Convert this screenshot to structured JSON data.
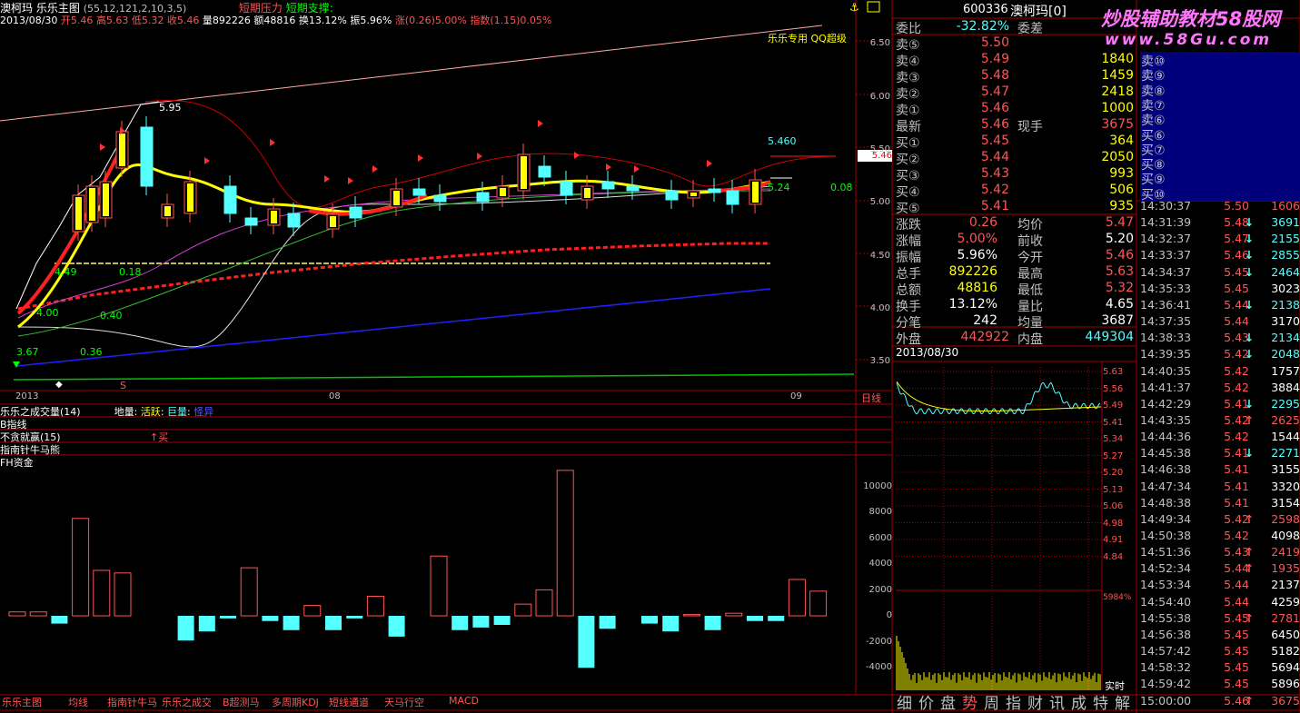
{
  "header": {
    "stock_name": "澳柯玛",
    "indicator_title": "乐乐主图",
    "indicator_params": "(55,12,121,2,10,3,5)",
    "pressure_label": "短期压力",
    "support_label": "短期支撑:",
    "date": "2013/08/30",
    "open": "开5.46",
    "high": "高5.63",
    "low": "低5.32",
    "close": "收5.46",
    "volume": "量892226",
    "amount": "额48816",
    "turnover": "换13.12%",
    "amplitude": "振5.96%",
    "change": "涨(0.26)5.00%",
    "index": "指数(1.15)0.05%"
  },
  "chart_annotations": {
    "special_label": "乐乐专用  QQ超级",
    "high_mark": "5.95",
    "right_mark": "5.460",
    "value_524": "5.24",
    "value_008": "0.08",
    "value_018": "0.18",
    "value_040": "0.40",
    "value_036": "0.36",
    "value_367": "3.67",
    "value_400": "4.00",
    "value_449": "4.49",
    "current_price_tag": "5.46",
    "price_axis": [
      "6.50",
      "6.00",
      "5.50",
      "5.00",
      "4.50",
      "4.00",
      "3.50"
    ],
    "date_axis": [
      "2013",
      "08",
      "09"
    ],
    "sub_tab": "日线"
  },
  "indicators": {
    "ind1_name": "乐乐之成交量(14)",
    "ind1_items": [
      "地量",
      "活跃",
      "巨量",
      "怪异"
    ],
    "ind2_name": "B指线",
    "ind3_name": "不贪就赢(15)",
    "ind3_signal": "买",
    "ind4_name": "指南针牛马熊",
    "ind5_name": "FH资金",
    "fund_axis": [
      "10000",
      "8000",
      "6000",
      "4000",
      "2000",
      "0",
      "-2000",
      "-4000"
    ]
  },
  "chart_data": {
    "type": "bar",
    "title": "FH资金",
    "values": [
      300,
      300,
      -600,
      7500,
      3500,
      3300,
      0,
      0,
      -1900,
      -1200,
      -200,
      3700,
      -400,
      -1100,
      800,
      -1100,
      -200,
      1500,
      -1600,
      0,
      4600,
      -1100,
      -900,
      -700,
      900,
      2000,
      11200,
      -4000,
      -1000,
      0,
      -600,
      -1200,
      100,
      -1100,
      200,
      -400,
      -400,
      2800,
      1900
    ],
    "ylim": [
      -5000,
      11500
    ]
  },
  "quote": {
    "code": "600336",
    "name": "澳柯玛[0]",
    "weibi_label": "委比",
    "weibi_value": "-32.82%",
    "weicha_label": "委差",
    "sells": [
      {
        "label": "卖⑤",
        "price": "5.50",
        "vol": ""
      },
      {
        "label": "卖④",
        "price": "5.49",
        "vol": "1840"
      },
      {
        "label": "卖③",
        "price": "5.48",
        "vol": "1459"
      },
      {
        "label": "卖②",
        "price": "5.47",
        "vol": "2418"
      },
      {
        "label": "卖①",
        "price": "5.46",
        "vol": "1000"
      }
    ],
    "latest_label": "最新",
    "latest_price": "5.46",
    "now_hand_label": "现手",
    "now_hand": "3675",
    "buys": [
      {
        "label": "买①",
        "price": "5.45",
        "vol": "364"
      },
      {
        "label": "买②",
        "price": "5.44",
        "vol": "2050"
      },
      {
        "label": "买③",
        "price": "5.43",
        "vol": "993"
      },
      {
        "label": "买④",
        "price": "5.42",
        "vol": "506"
      },
      {
        "label": "买⑤",
        "price": "5.41",
        "vol": "935"
      }
    ],
    "stats": [
      {
        "l1": "涨跌",
        "v1": "0.26",
        "l2": "均价",
        "v2": "5.47"
      },
      {
        "l1": "涨幅",
        "v1": "5.00%",
        "l2": "前收",
        "v2": "5.20"
      },
      {
        "l1": "振幅",
        "v1": "5.96%",
        "l2": "今开",
        "v2": "5.46"
      },
      {
        "l1": "总手",
        "v1": "892226",
        "l2": "最高",
        "v2": "5.63"
      },
      {
        "l1": "总额",
        "v1": "48816",
        "l2": "最低",
        "v2": "5.32"
      },
      {
        "l1": "换手",
        "v1": "13.12%",
        "l2": "量比",
        "v2": "4.65"
      },
      {
        "l1": "分笔",
        "v1": "242",
        "l2": "均量",
        "v2": "3687"
      }
    ],
    "outer_label": "外盘",
    "outer_value": "442922",
    "inner_label": "内盘",
    "inner_value": "449304",
    "mini_date": "2013/08/30",
    "mini_axis": [
      "5.63",
      "5.56",
      "5.49",
      "5.41",
      "5.34",
      "5.27",
      "5.20",
      "5.13",
      "5.06",
      "4.98",
      "4.91",
      "4.84"
    ],
    "mini_pct": "5984%",
    "realtime_label": "实时"
  },
  "depth_labels": [
    "卖⑩",
    "卖⑨",
    "卖⑧",
    "卖⑦",
    "卖⑥",
    "买⑥",
    "买⑦",
    "买⑧",
    "买⑨",
    "买⑩"
  ],
  "ticks": [
    {
      "t": "14:30:37",
      "p": "5.50",
      "a": "",
      "v": "1606",
      "c": "red"
    },
    {
      "t": "14:31:39",
      "p": "5.48",
      "a": "↓",
      "v": "3691",
      "c": "cyan"
    },
    {
      "t": "14:32:37",
      "p": "5.47",
      "a": "↓",
      "v": "2155",
      "c": "cyan"
    },
    {
      "t": "14:33:37",
      "p": "5.46",
      "a": "↓",
      "v": "2855",
      "c": "cyan"
    },
    {
      "t": "14:34:37",
      "p": "5.45",
      "a": "↓",
      "v": "2464",
      "c": "cyan"
    },
    {
      "t": "14:35:33",
      "p": "5.45",
      "a": "",
      "v": "3023",
      "c": "wht"
    },
    {
      "t": "14:36:41",
      "p": "5.44",
      "a": "↓",
      "v": "2138",
      "c": "cyan"
    },
    {
      "t": "14:37:35",
      "p": "5.44",
      "a": "",
      "v": "3170",
      "c": "wht"
    },
    {
      "t": "14:38:33",
      "p": "5.43",
      "a": "↓",
      "v": "2134",
      "c": "cyan"
    },
    {
      "t": "14:39:35",
      "p": "5.42",
      "a": "↓",
      "v": "2048",
      "c": "cyan"
    },
    {
      "t": "14:40:35",
      "p": "5.42",
      "a": "",
      "v": "1757",
      "c": "wht"
    },
    {
      "t": "14:41:37",
      "p": "5.42",
      "a": "",
      "v": "3884",
      "c": "wht"
    },
    {
      "t": "14:42:29",
      "p": "5.41",
      "a": "↓",
      "v": "2295",
      "c": "cyan"
    },
    {
      "t": "14:43:35",
      "p": "5.42",
      "a": "↑",
      "v": "2625",
      "c": "red"
    },
    {
      "t": "14:44:36",
      "p": "5.42",
      "a": "",
      "v": "1544",
      "c": "wht"
    },
    {
      "t": "14:45:38",
      "p": "5.41",
      "a": "↓",
      "v": "2271",
      "c": "cyan"
    },
    {
      "t": "14:46:38",
      "p": "5.41",
      "a": "",
      "v": "3155",
      "c": "wht"
    },
    {
      "t": "14:47:34",
      "p": "5.41",
      "a": "",
      "v": "3320",
      "c": "wht"
    },
    {
      "t": "14:48:38",
      "p": "5.41",
      "a": "",
      "v": "3154",
      "c": "wht"
    },
    {
      "t": "14:49:34",
      "p": "5.42",
      "a": "↑",
      "v": "2598",
      "c": "red"
    },
    {
      "t": "14:50:38",
      "p": "5.42",
      "a": "",
      "v": "4098",
      "c": "wht"
    },
    {
      "t": "14:51:36",
      "p": "5.43",
      "a": "↑",
      "v": "2419",
      "c": "red"
    },
    {
      "t": "14:52:34",
      "p": "5.44",
      "a": "↑",
      "v": "1935",
      "c": "red"
    },
    {
      "t": "14:53:34",
      "p": "5.44",
      "a": "",
      "v": "2137",
      "c": "wht"
    },
    {
      "t": "14:54:40",
      "p": "5.44",
      "a": "",
      "v": "4259",
      "c": "wht"
    },
    {
      "t": "14:55:38",
      "p": "5.45",
      "a": "↑",
      "v": "2781",
      "c": "red"
    },
    {
      "t": "14:56:38",
      "p": "5.45",
      "a": "",
      "v": "6450",
      "c": "wht"
    },
    {
      "t": "14:57:42",
      "p": "5.45",
      "a": "",
      "v": "5182",
      "c": "wht"
    },
    {
      "t": "14:58:32",
      "p": "5.45",
      "a": "",
      "v": "5694",
      "c": "wht"
    },
    {
      "t": "14:59:42",
      "p": "5.45",
      "a": "",
      "v": "5896",
      "c": "wht"
    },
    {
      "t": "15:00:00",
      "p": "5.46",
      "a": "↑",
      "v": "3675",
      "c": "red"
    }
  ],
  "watermark": {
    "line1": "炒股辅助教材58股网",
    "line2": "www.58Gu.com"
  },
  "bottom_tabs": [
    "乐乐主图",
    "均线",
    "指南针牛马",
    "乐乐之成交",
    "B超测马",
    "多周期KDJ",
    "短线通道",
    "天马行空",
    "MACD"
  ],
  "side_tabs": [
    "细",
    "价",
    "盘",
    "势",
    "周",
    "指",
    "财",
    "讯",
    "成",
    "特",
    "解"
  ],
  "colors": {
    "up": "#ff5555",
    "down": "#54ffff",
    "grid": "#a00000",
    "yellow_line": "#ffff00",
    "accent_blue": "#00007a"
  }
}
